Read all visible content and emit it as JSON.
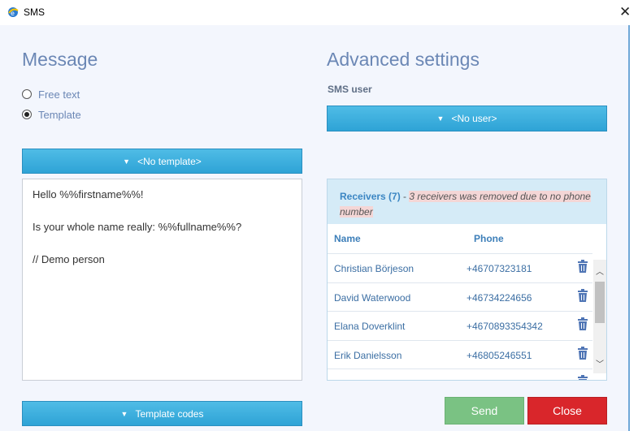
{
  "window": {
    "title": "SMS",
    "close_glyph": "✕"
  },
  "message": {
    "heading": "Message",
    "radio_free_text": "Free text",
    "radio_template": "Template",
    "selected": "Template",
    "template_dropdown": "<No template>",
    "body_lines": [
      "Hello %%firstname%%!",
      "",
      "Is your whole name really: %%fullname%%?",
      "",
      "// Demo person"
    ],
    "template_codes_button": "Template codes"
  },
  "advanced": {
    "heading": "Advanced settings",
    "sms_user_label": "SMS user",
    "user_dropdown": "<No user>"
  },
  "receivers": {
    "title": "Receivers (7)",
    "separator": " - ",
    "note": "3 receivers was removed due to no phone number",
    "columns": {
      "name": "Name",
      "phone": "Phone"
    },
    "rows": [
      {
        "name": "Christian Börjeson",
        "phone": "+46707323181"
      },
      {
        "name": "David Waterwood",
        "phone": "+46734224656"
      },
      {
        "name": "Elana Doverklint",
        "phone": "+4670893354342"
      },
      {
        "name": "Erik Danielsson",
        "phone": "+46805246551"
      },
      {
        "name": "",
        "phone": ""
      }
    ]
  },
  "buttons": {
    "send": "Send",
    "close": "Close"
  },
  "colors": {
    "accent_blue": "#2ea3d6",
    "heading": "#6b87b5",
    "send_green": "#7ac283",
    "close_red": "#d9262b"
  },
  "icons": {
    "app": "app-icon",
    "trash": "trash-icon",
    "caret": "caret-down-icon"
  }
}
